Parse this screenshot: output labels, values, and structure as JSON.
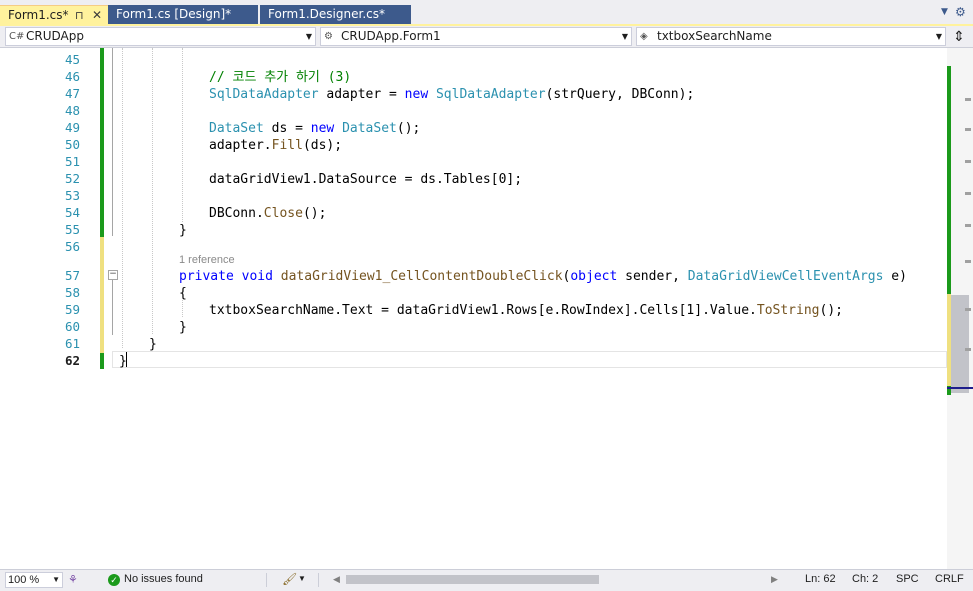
{
  "tabs": [
    {
      "label": "Form1.cs*",
      "pin": "⊓",
      "close": "✕",
      "active": true
    },
    {
      "label": "Form1.cs [Design]*",
      "active": false
    },
    {
      "label": "Form1.Designer.cs*",
      "active": false
    }
  ],
  "navbar": {
    "project": "CRUDApp",
    "class": "CRUDApp.Form1",
    "member": "txtboxSearchName"
  },
  "editor": {
    "line_numbers": [
      "45",
      "46",
      "47",
      "48",
      "49",
      "50",
      "51",
      "52",
      "53",
      "54",
      "55",
      "56",
      "57",
      "58",
      "59",
      "60",
      "61",
      "62"
    ],
    "current_line": "62",
    "codelens": "1 reference",
    "lines": [
      "",
      "// 코드 추가 하기 (3)",
      "SqlDataAdapter adapter = new SqlDataAdapter(strQuery, DBConn);",
      "",
      "DataSet ds = new DataSet();",
      "adapter.Fill(ds);",
      "",
      "dataGridView1.DataSource = ds.Tables[0];",
      "",
      "DBConn.Close();",
      "}",
      "",
      "private void dataGridView1_CellContentDoubleClick(object sender, DataGridViewCellEventArgs e)",
      "{",
      "txtboxSearchName.Text = dataGridView1.Rows[e.RowIndex].Cells[1].Value.ToString();",
      "}",
      "}",
      "}"
    ]
  },
  "statusbar": {
    "zoom": "100 %",
    "issues": "No issues found",
    "line": "Ln: 62",
    "col": "Ch: 2",
    "whitespace": "SPC",
    "eol": "CRLF"
  },
  "colors": {
    "keyword": "#0000ff",
    "type": "#2b91af",
    "comment": "#008000",
    "method": "#74531f",
    "saved_change": "#1b9a1b",
    "unsaved_change": "#efe080",
    "active_tab": "#fff29d",
    "inactive_tab": "#3d5a8c"
  }
}
